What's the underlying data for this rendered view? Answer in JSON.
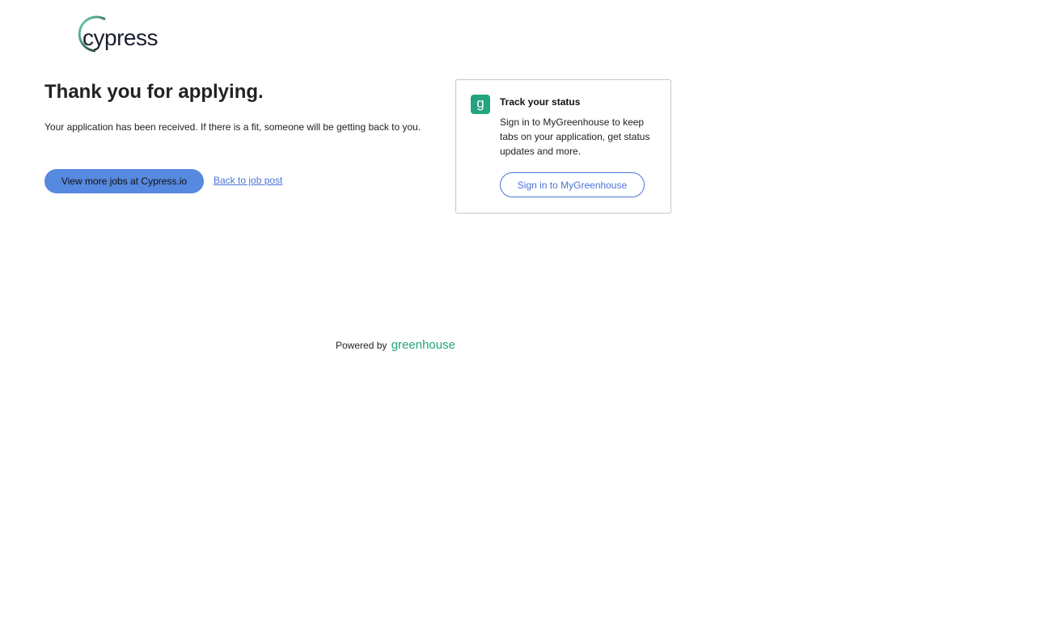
{
  "header": {
    "logo_text": "cypress"
  },
  "main": {
    "title": "Thank you for applying.",
    "message": "Your application has been received. If there is a fit, someone will be getting back to you.",
    "primary_button": "View more jobs at Cypress.io",
    "back_link": "Back to job post"
  },
  "card": {
    "icon_glyph": "g",
    "title": "Track your status",
    "text": "Sign in to MyGreenhouse to keep tabs on your application, get status updates and more.",
    "button": "Sign in to MyGreenhouse"
  },
  "footer": {
    "powered_by": "Powered by",
    "brand": "greenhouse"
  },
  "colors": {
    "accent": "#5689e0",
    "link": "#4a74d8",
    "greenhouse": "#24a47f"
  }
}
